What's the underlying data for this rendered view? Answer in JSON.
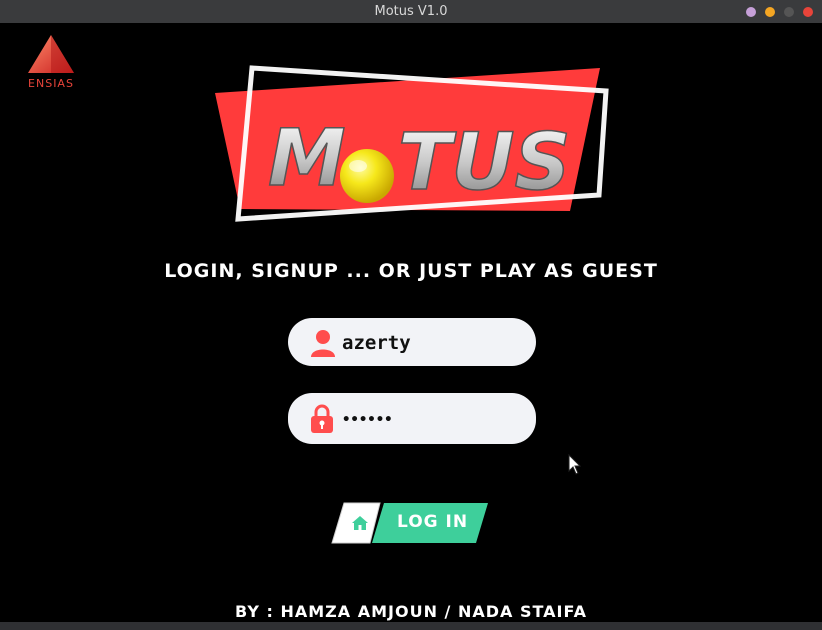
{
  "window": {
    "title": "Motus V1.0",
    "controls": [
      {
        "name": "minimize",
        "color": "#c6a0d8"
      },
      {
        "name": "maximize",
        "color": "#f5a623"
      },
      {
        "name": "inactive",
        "color": "#555555"
      },
      {
        "name": "close",
        "color": "#e8443a"
      }
    ]
  },
  "branding": {
    "school_logo_text": "ENSIAS",
    "game_logo_text": "MOTUS",
    "accent_color": "#ff3b3b"
  },
  "login": {
    "subtitle": "LOGIN, SIGNUP ... OR JUST PLAY AS GUEST",
    "username_value": "azerty",
    "password_value": "******",
    "user_icon": "user-icon",
    "lock_icon": "lock-icon",
    "home_icon": "home-icon",
    "button_label": "LOG IN",
    "button_color": "#3ecf9b"
  },
  "footer": {
    "credits": "BY : HAMZA AMJOUN / NADA STAIFA"
  }
}
